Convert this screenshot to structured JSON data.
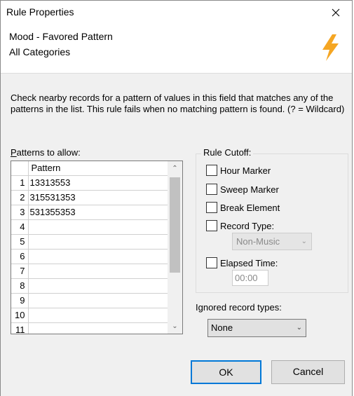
{
  "window": {
    "title": "Rule Properties"
  },
  "header": {
    "line1": "Mood - Favored Pattern",
    "line2": "All Categories",
    "icon": "lightning-bolt-icon",
    "icon_color": "#f5a623"
  },
  "description": "Check nearby records for a pattern of values in this field that matches any of the patterns in the list. This rule fails when no matching pattern is found. (? = Wildcard)",
  "patterns": {
    "label_hotkey": "P",
    "label_rest": "atterns to allow:",
    "column_header": "Pattern",
    "rows": [
      {
        "num": "1",
        "value": "13313553"
      },
      {
        "num": "2",
        "value": "315531353"
      },
      {
        "num": "3",
        "value": "531355353"
      },
      {
        "num": "4",
        "value": ""
      },
      {
        "num": "5",
        "value": ""
      },
      {
        "num": "6",
        "value": ""
      },
      {
        "num": "7",
        "value": ""
      },
      {
        "num": "8",
        "value": ""
      },
      {
        "num": "9",
        "value": ""
      },
      {
        "num": "10",
        "value": ""
      },
      {
        "num": "11",
        "value": ""
      }
    ]
  },
  "cutoff": {
    "title": "Rule Cutoff:",
    "hour_marker": "Hour Marker",
    "sweep_marker": "Sweep Marker",
    "break_element": "Break Element",
    "record_type": "Record Type:",
    "record_type_value": "Non-Music",
    "elapsed_time": "Elapsed Time:",
    "elapsed_time_value": "00:00"
  },
  "ignored": {
    "label": "Ignored record types:",
    "value": "None"
  },
  "buttons": {
    "ok": "OK",
    "cancel": "Cancel"
  },
  "colors": {
    "focus_border": "#0078d7",
    "dialog_bg": "#f0f0f0"
  }
}
